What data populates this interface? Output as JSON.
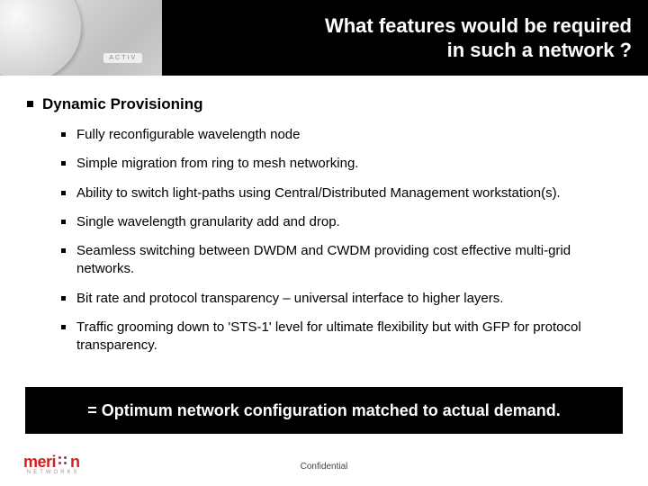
{
  "header": {
    "title_line1": "What features would be required",
    "title_line2": "in such a network ?"
  },
  "body": {
    "heading": "Dynamic Provisioning",
    "items": [
      "Fully reconfigurable wavelength node",
      "Simple migration from ring to mesh networking.",
      "Ability to switch light-paths using Central/Distributed Management workstation(s).",
      "Single wavelength granularity add and drop.",
      "Seamless switching between DWDM and CWDM providing cost effective multi-grid networks.",
      "Bit rate and protocol transparency – universal interface to higher layers.",
      "Traffic grooming down to 'STS-1' level for ultimate flexibility but with GFP for protocol transparency."
    ]
  },
  "conclusion": "= Optimum network configuration matched to actual demand.",
  "footer": {
    "logo_main_left": "meri",
    "logo_main_right": "n",
    "logo_sub": "NETWORKS",
    "confidential": "Confidential"
  }
}
